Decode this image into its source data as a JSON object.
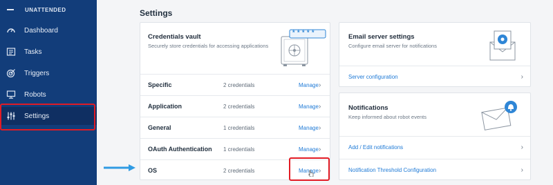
{
  "sidebar": {
    "title": "UNATTENDED",
    "items": [
      {
        "label": "Dashboard",
        "icon": "dashboard-gauge-icon"
      },
      {
        "label": "Tasks",
        "icon": "tasks-list-icon"
      },
      {
        "label": "Triggers",
        "icon": "triggers-target-icon"
      },
      {
        "label": "Robots",
        "icon": "robots-monitor-icon"
      },
      {
        "label": "Settings",
        "icon": "settings-sliders-icon",
        "active": true
      }
    ]
  },
  "main": {
    "title": "Settings",
    "vault": {
      "title": "Credentials vault",
      "subtitle": "Securely store credentials for accessing applications",
      "password_mask": "* * * * *",
      "rows": [
        {
          "name": "Specific",
          "count": "2 credentials",
          "action": "Manage"
        },
        {
          "name": "Application",
          "count": "2 credentials",
          "action": "Manage"
        },
        {
          "name": "General",
          "count": "1 credentials",
          "action": "Manage"
        },
        {
          "name": "OAuth Authentication",
          "count": "1 credentials",
          "action": "Manage"
        },
        {
          "name": "OS",
          "count": "2 credentials",
          "action": "Manage"
        }
      ]
    },
    "email": {
      "title": "Email server settings",
      "subtitle": "Configure email server for notifications",
      "link": "Server configuration"
    },
    "notifications": {
      "title": "Notifications",
      "subtitle": "Keep informed about robot events",
      "links": [
        "Add / Edit notifications",
        "Notification Threshold Configuration"
      ]
    }
  },
  "colors": {
    "sidebar_bg": "#123d7a",
    "sidebar_active": "#0f2f62",
    "accent_link": "#1f7ad6",
    "highlight_red": "#e21b24",
    "arrow_blue": "#2f9be3"
  }
}
